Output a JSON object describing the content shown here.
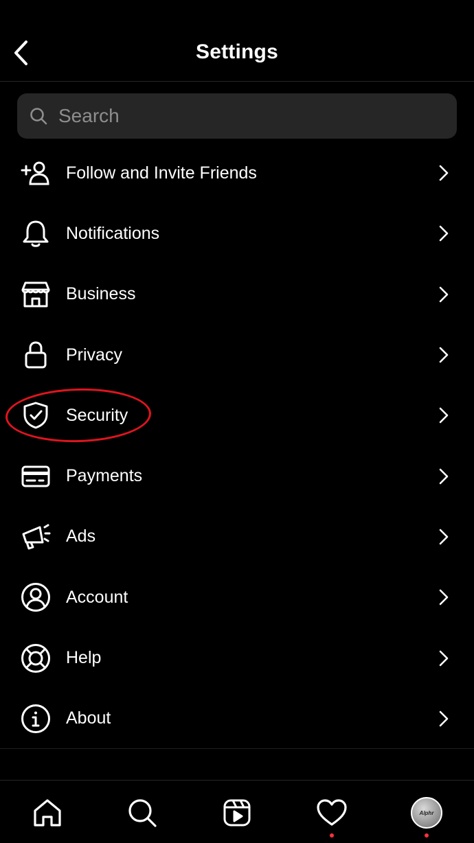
{
  "header": {
    "title": "Settings"
  },
  "search": {
    "placeholder": "Search"
  },
  "menu": [
    {
      "label": "Follow and Invite Friends",
      "icon": "add-user-icon"
    },
    {
      "label": "Notifications",
      "icon": "bell-icon"
    },
    {
      "label": "Business",
      "icon": "store-icon"
    },
    {
      "label": "Privacy",
      "icon": "lock-icon"
    },
    {
      "label": "Security",
      "icon": "shield-check-icon"
    },
    {
      "label": "Payments",
      "icon": "credit-card-icon"
    },
    {
      "label": "Ads",
      "icon": "megaphone-icon"
    },
    {
      "label": "Account",
      "icon": "user-circle-icon"
    },
    {
      "label": "Help",
      "icon": "lifebuoy-icon"
    },
    {
      "label": "About",
      "icon": "info-icon"
    }
  ],
  "annotation": {
    "highlighted_item": "Security",
    "color": "#e0141f"
  },
  "tabbar": {
    "tabs": [
      "home-icon",
      "search-icon",
      "reels-icon",
      "heart-icon",
      "profile-avatar"
    ],
    "avatar_text": "Alphr",
    "notification_color": "#ff3040"
  }
}
